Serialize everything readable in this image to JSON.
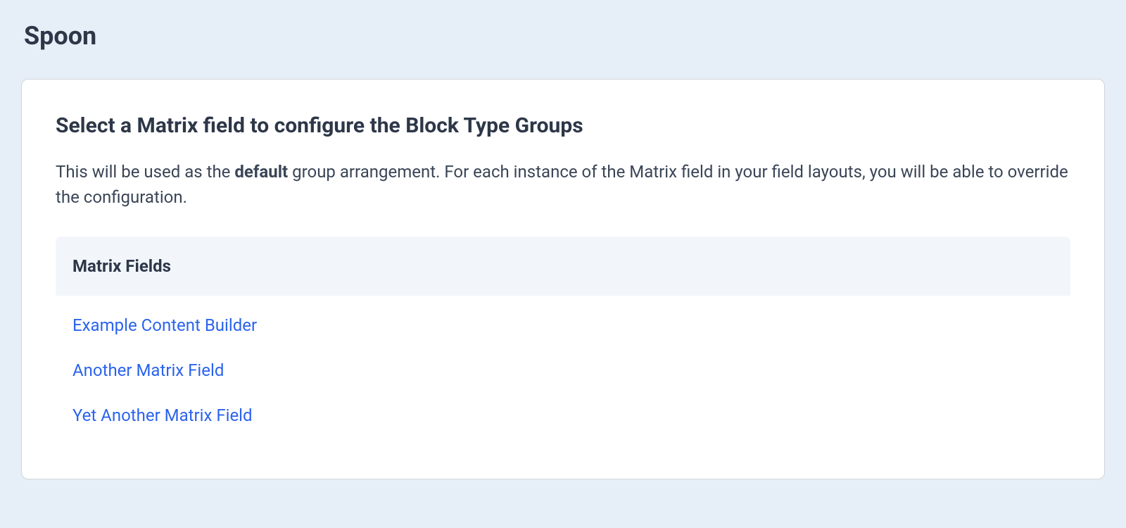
{
  "page": {
    "title": "Spoon"
  },
  "card": {
    "heading": "Select a Matrix field to configure the Block Type Groups",
    "description_prefix": "This will be used as the ",
    "description_bold": "default",
    "description_suffix": " group arrangement. For each instance of the Matrix field in your field layouts, you will be able to override the configuration."
  },
  "list": {
    "header": "Matrix Fields",
    "items": [
      "Example Content Builder",
      "Another Matrix Field",
      "Yet Another Matrix Field"
    ]
  }
}
